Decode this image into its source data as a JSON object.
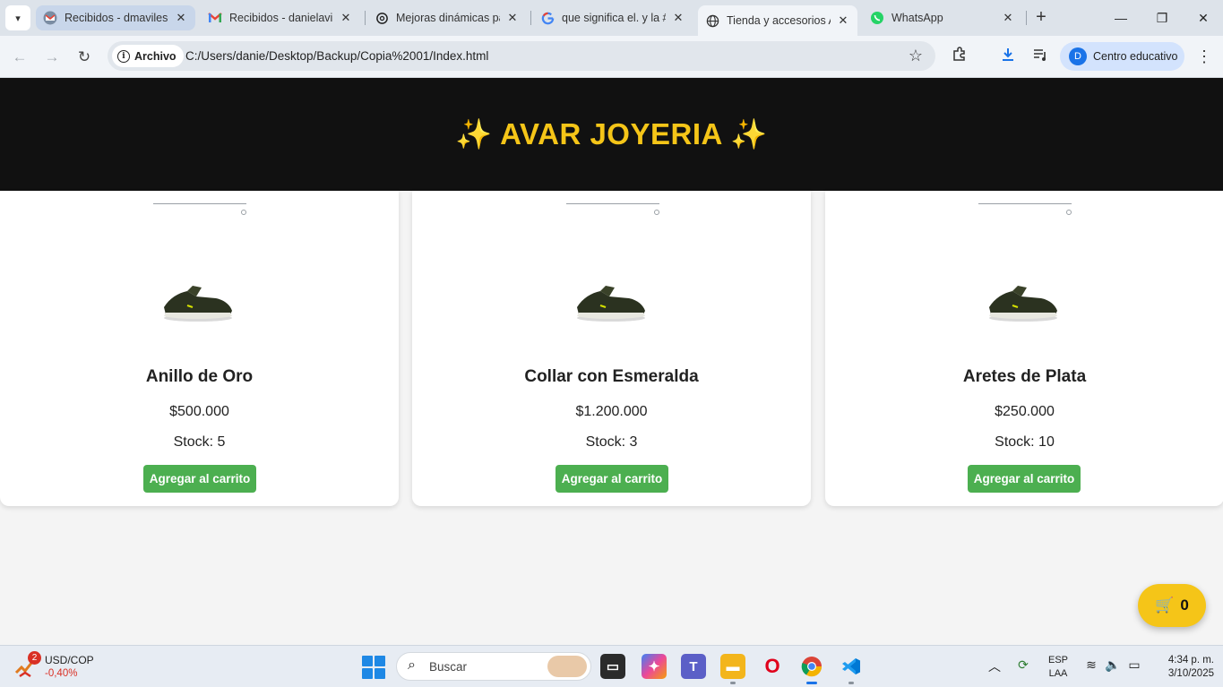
{
  "browser": {
    "tabs": [
      {
        "title": "Recibidos - dmavilesc",
        "icon": "gmail-icon"
      },
      {
        "title": "Recibidos - danielavil",
        "icon": "gmail-icon"
      },
      {
        "title": "Mejoras dinámicas pá",
        "icon": "chatgpt-icon"
      },
      {
        "title": "que significa el. y la #",
        "icon": "google-icon"
      },
      {
        "title": "Tienda y accesorios A",
        "icon": "globe-icon"
      },
      {
        "title": "WhatsApp",
        "icon": "whatsapp-icon"
      }
    ],
    "active_tab_index": 4,
    "chip_label": "Archivo",
    "url": "C:/Users/danie/Desktop/Backup/Copia%2001/Index.html",
    "profile_initial": "D",
    "profile_name": "Centro educativo"
  },
  "site": {
    "title": "✨ AVAR JOYERIA ✨",
    "title_color": "#f5c518",
    "products": [
      {
        "name": "Anillo de Oro",
        "price": "$500.000",
        "stock": "Stock: 5",
        "button": "Agregar al carrito"
      },
      {
        "name": "Collar con Esmeralda",
        "price": "$1.200.000",
        "stock": "Stock: 3",
        "button": "Agregar al carrito"
      },
      {
        "name": "Aretes de Plata",
        "price": "$250.000",
        "stock": "Stock: 10",
        "button": "Agregar al carrito"
      }
    ],
    "button_color": "#4caf50",
    "cart_icon": "🛒",
    "cart_count": "0"
  },
  "taskbar": {
    "widget_badge": "2",
    "widget_title": "USD/COP",
    "widget_value": "-0,40%",
    "search_placeholder": "Buscar",
    "lang_line1": "ESP",
    "lang_line2": "LAA",
    "time": "4:34 p. m.",
    "date": "3/10/2025"
  }
}
